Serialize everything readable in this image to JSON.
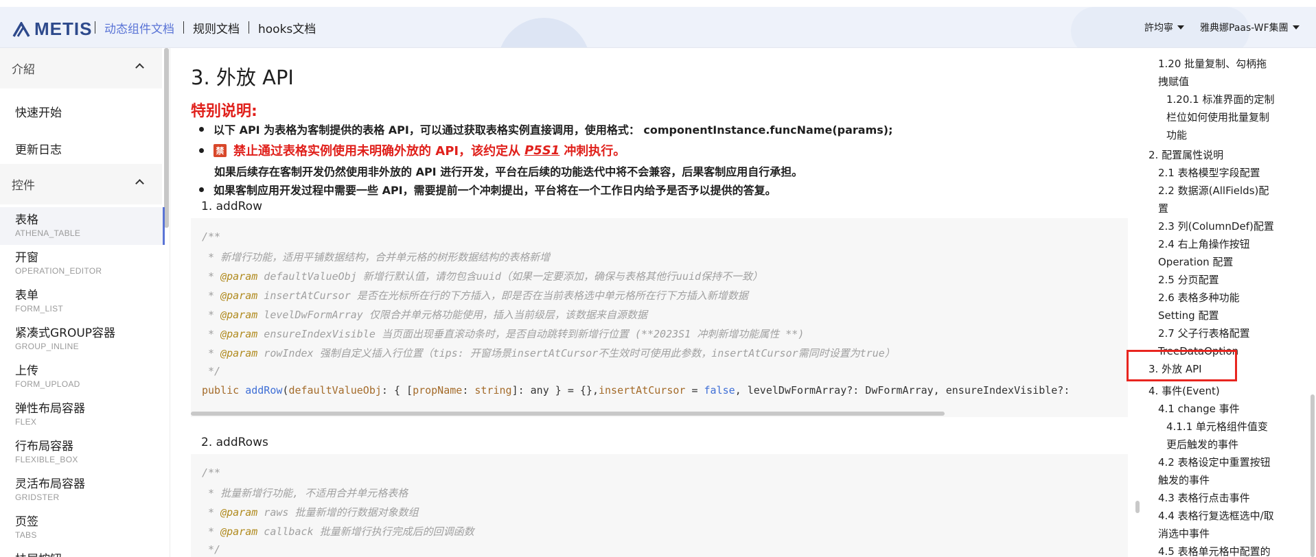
{
  "header": {
    "logo": "METIS",
    "nav": [
      {
        "label": "动态组件文档",
        "active": true
      },
      {
        "label": "规则文档",
        "active": false
      },
      {
        "label": "hooks文档",
        "active": false
      }
    ],
    "user": "許均寧",
    "org": "雅典娜Paas-WF集團"
  },
  "sidebar": {
    "group_intro": "介紹",
    "intro_items": [
      "快速开始",
      "更新日志"
    ],
    "group_controls": "控件",
    "items": [
      {
        "title": "表格",
        "sub": "ATHENA_TABLE",
        "active": true
      },
      {
        "title": "开窗",
        "sub": "OPERATION_EDITOR"
      },
      {
        "title": "表单",
        "sub": "FORM_LIST"
      },
      {
        "title": "紧凑式GROUP容器",
        "sub": "GROUP_INLINE"
      },
      {
        "title": "上传",
        "sub": "FORM_UPLOAD"
      },
      {
        "title": "弹性布局容器",
        "sub": "FLEX"
      },
      {
        "title": "行布局容器",
        "sub": "FLEXIBLE_BOX"
      },
      {
        "title": "灵活布局容器",
        "sub": "GRIDSTER"
      },
      {
        "title": "页签",
        "sub": "TABS"
      },
      {
        "title": "扶层按钮",
        "sub": ""
      }
    ]
  },
  "main": {
    "title": "3. 外放 API",
    "special": "特别说明:",
    "bullet1": "以下 API 为表格为客制提供的表格 API，可以通过获取表格实例直接调用，使用格式： componentInstance.funcName(params);",
    "ban_icon": "禁",
    "bullet2_a": "禁止通过表格实例使用未明确外放的 API，该约定从",
    "bullet2_ref": "P5S1",
    "bullet2_b": "冲刺执行。",
    "para": "如果后续存在客制开发仍然使用非外放的 API 进行开发，平台在后续的功能迭代中将不会兼容，后果客制应用自行承担。",
    "bullet3": "如果客制应用开发过程中需要一些 API，需要提前一个冲刺提出，平台将在一个工作日内给予是否予以提供的答复。",
    "sub1": "1. addRow",
    "sub2": "2. addRows",
    "code1": {
      "open": "/**",
      "desc": " * 新增行功能，适用平铺数据结构，合并单元格的树形数据结构的表格新增",
      "params": [
        {
          "tag": "@param",
          "text": " defaultValueObj 新增行默认值，请勿包含uuid（如果一定要添加，确保与表格其他行uuid保持不一致）"
        },
        {
          "tag": "@param",
          "text": " insertAtCursor 是否在光标所在行的下方插入，即是否在当前表格选中单元格所在行下方插入新增数据"
        },
        {
          "tag": "@param",
          "text": " levelDwFormArray 仅限合并单元格功能使用，插入当前级层，该数据来自源数据"
        },
        {
          "tag": "@param",
          "text": " ensureIndexVisible 当页面出现垂直滚动条时，是否自动跳转到新增行位置 (**2023S1 冲刺新增功能属性 **)"
        },
        {
          "tag": "@param",
          "text": " rowIndex 强制自定义插入行位置（tips: 开窗场景insertAtCursor不生效时可使用此参数，insertAtCursor需同时设置为true）"
        }
      ],
      "close": " */",
      "sig_public": "public ",
      "sig_fn": "addRow",
      "sig_a": "(",
      "sig_p1": "defaultValueObj",
      "sig_b": ": { [",
      "sig_p2": "propName",
      "sig_c": ": ",
      "sig_t1": "string",
      "sig_d": "]: any } = {},",
      "sig_p3": "insertAtCursor",
      "sig_e": " = ",
      "sig_false": "false",
      "sig_f": ", levelDwFormArray?: DwFormArray, ensureIndexVisible?:"
    },
    "code2": {
      "open": "/**",
      "desc": " * 批量新增行功能, 不适用合并单元格表格",
      "params": [
        {
          "tag": "@param",
          "text": " raws 批量新增的行数据对象数组"
        },
        {
          "tag": "@param",
          "text": " callback 批量新增行执行完成后的回调函数"
        }
      ],
      "close": " */"
    }
  },
  "toc": {
    "items": [
      {
        "label": "1.20 批量复制、勾柄拖",
        "level": 2
      },
      {
        "label": "拽赋值",
        "level": 2
      },
      {
        "label": "1.20.1 标准界面的定制",
        "level": 3
      },
      {
        "label": "栏位如何使用批量复制",
        "level": 3
      },
      {
        "label": "功能",
        "level": 3
      },
      {
        "label": "2. 配置属性说明",
        "level": 1
      },
      {
        "label": "2.1 表格模型字段配置",
        "level": 2
      },
      {
        "label": "2.2 数据源(AllFields)配",
        "level": 2
      },
      {
        "label": "置",
        "level": 2
      },
      {
        "label": "2.3 列(ColumnDef)配置",
        "level": 2
      },
      {
        "label": "2.4 右上角操作按钮",
        "level": 2
      },
      {
        "label": "Operation 配置",
        "level": 2
      },
      {
        "label": "2.5 分页配置",
        "level": 2
      },
      {
        "label": "2.6 表格多种功能",
        "level": 2
      },
      {
        "label": "Setting 配置",
        "level": 2
      },
      {
        "label": "2.7 父子行表格配置",
        "level": 2
      },
      {
        "label": "TreeDataOption",
        "level": 2
      },
      {
        "label": "3. 外放 API",
        "level": 1
      },
      {
        "label": "4. 事件(Event)",
        "level": 1
      },
      {
        "label": "4.1 change 事件",
        "level": 2
      },
      {
        "label": "4.1.1 单元格组件值变",
        "level": 3
      },
      {
        "label": "更后触发的事件",
        "level": 3
      },
      {
        "label": "4.2 表格设定中重置按钮",
        "level": 2
      },
      {
        "label": "触发的事件",
        "level": 2
      },
      {
        "label": "4.3 表格行点击事件",
        "level": 2
      },
      {
        "label": "4.4 表格行复选框选中/取",
        "level": 2
      },
      {
        "label": "消选中事件",
        "level": 2
      },
      {
        "label": "4.5 表格单元格中配置的",
        "level": 2
      }
    ]
  },
  "colors": {
    "accent": "#5a74d6",
    "danger": "#e0201b",
    "highlight_box": "#e8251f"
  }
}
